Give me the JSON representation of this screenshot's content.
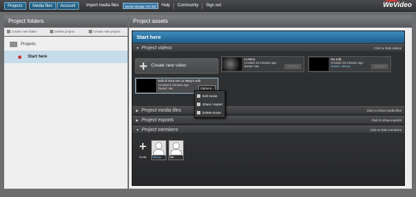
{
  "nav": {
    "projects": "Projects",
    "media_files": "Media files",
    "account": "Account",
    "import": "Import media files",
    "storage": "Media storage: 0% full",
    "help": "Help",
    "community": "Community",
    "sign_out": "Sign out",
    "logo": "WeVideo"
  },
  "left": {
    "title": "Project folders",
    "create_folder": "Create new folder",
    "delete_project": "Delete project",
    "create_project": "Create new project",
    "folder": "Projects",
    "project": "Start here"
  },
  "right": {
    "title": "Project assets",
    "project_title": "Start here",
    "videos_section": "Project videos",
    "videos_toggle": "Click to hide videos",
    "create_video": "Create new video",
    "videos": [
      {
        "name": "CUNKS",
        "created": "Created 43 minutes ago",
        "owner": "Owner: Me",
        "options": "Options"
      },
      {
        "name": "My Edit",
        "created": "Created 19 minutes ago",
        "owner": "Owner: tdeuzy",
        "options": "Options"
      },
      {
        "name": "Edit of Tous De La Wary's edit",
        "created": "Created 0 minutes ago",
        "owner": "Owner: Me",
        "options": "Options"
      }
    ],
    "menu": {
      "edit": "Edit movie",
      "share": "Share / export",
      "delete": "Delete movie"
    },
    "media_section": "Project media files",
    "media_toggle": "Click to show media files",
    "exports_section": "Project exports",
    "exports_toggle": "Click to show exports",
    "members_section": "Project members",
    "members_toggle": "Click to hide members",
    "invite": "Invite",
    "members": [
      "tdeuzy",
      "Me"
    ]
  }
}
